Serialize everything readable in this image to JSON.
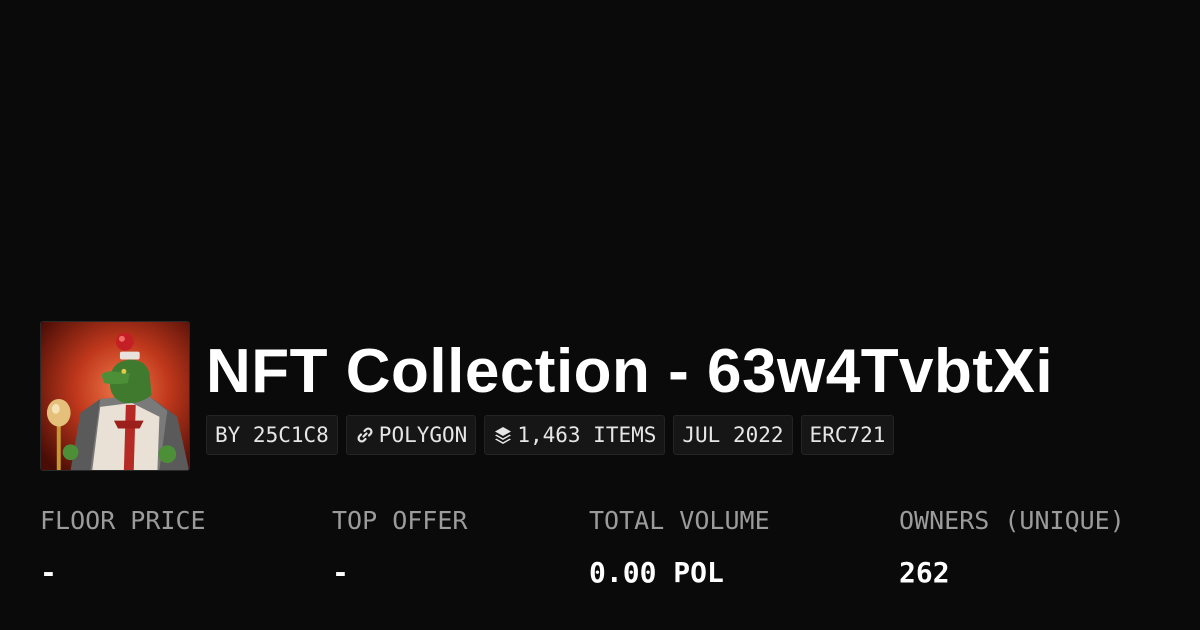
{
  "collection": {
    "title": "NFT Collection - 63w4TvbtXi"
  },
  "tags": {
    "creator": "BY 25C1C8",
    "chain": "POLYGON",
    "chain_icon": "link-icon",
    "items": "1,463 ITEMS",
    "items_icon": "layers-icon",
    "date": "JUL 2022",
    "standard": "ERC721"
  },
  "stats": {
    "floor_price": {
      "label": "FLOOR PRICE",
      "value": "-"
    },
    "top_offer": {
      "label": "TOP OFFER",
      "value": "-"
    },
    "total_volume": {
      "label": "TOTAL VOLUME",
      "value": "0.00 POL"
    },
    "owners": {
      "label": "OWNERS (UNIQUE)",
      "value": "262"
    }
  },
  "colors": {
    "background": "#0a0a0a",
    "text_primary": "#ffffff",
    "text_muted": "#9b9b9b",
    "tag_background": "#161616"
  }
}
